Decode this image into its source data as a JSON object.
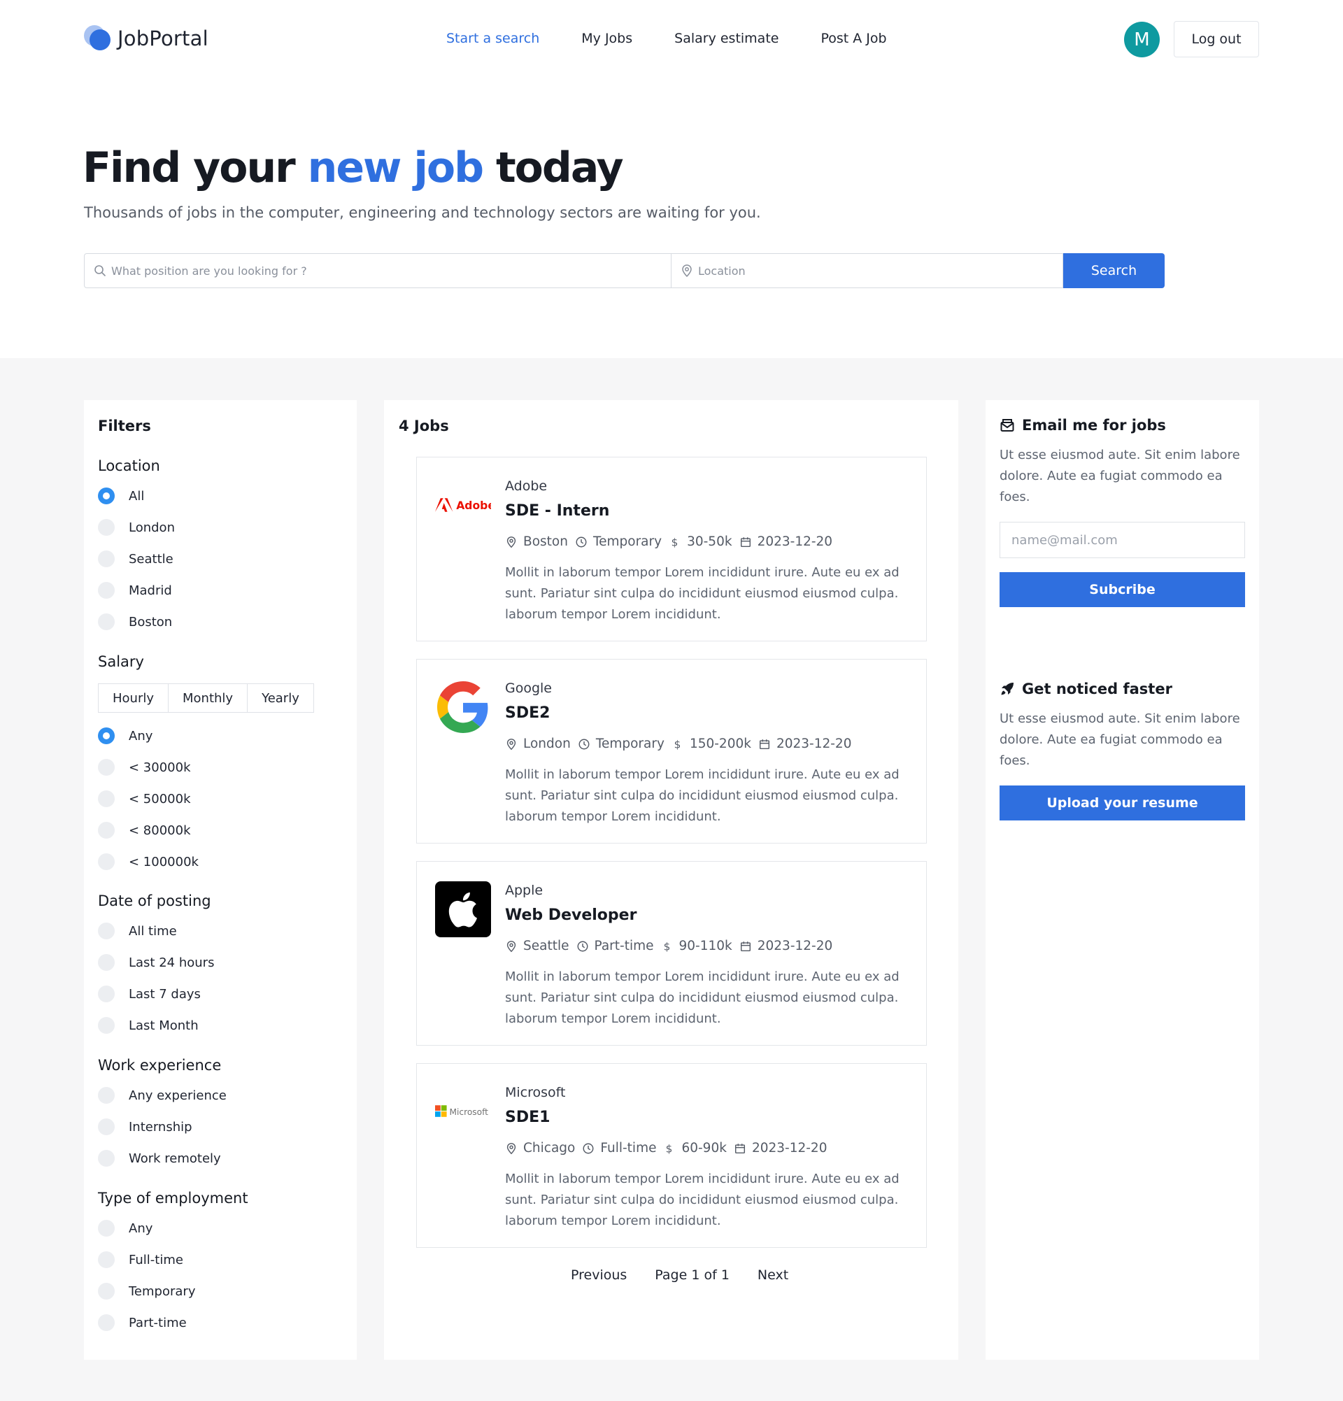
{
  "brand": {
    "name": "JobPortal"
  },
  "nav": {
    "items": [
      {
        "label": "Start a search",
        "active": true
      },
      {
        "label": "My Jobs",
        "active": false
      },
      {
        "label": "Salary estimate",
        "active": false
      },
      {
        "label": "Post A Job",
        "active": false
      }
    ]
  },
  "user": {
    "avatar_initial": "M",
    "logout_label": "Log out"
  },
  "hero": {
    "title_start": "Find your ",
    "title_highlight": "new job",
    "title_end": " today",
    "subtitle": "Thousands of jobs in the computer, engineering and technology sectors are waiting for you."
  },
  "search": {
    "position_placeholder": "What position are you looking for ?",
    "location_placeholder": "Location",
    "button_label": "Search"
  },
  "filters": {
    "title": "Filters",
    "location": {
      "title": "Location",
      "options": [
        "All",
        "London",
        "Seattle",
        "Madrid",
        "Boston"
      ],
      "selected": "All"
    },
    "salary": {
      "title": "Salary",
      "periods": [
        "Hourly",
        "Monthly",
        "Yearly"
      ],
      "options": [
        "Any",
        "< 30000k",
        "< 50000k",
        "< 80000k",
        "< 100000k"
      ],
      "selected": "Any"
    },
    "date": {
      "title": "Date of posting",
      "options": [
        "All time",
        "Last 24 hours",
        "Last 7 days",
        "Last Month"
      ]
    },
    "experience": {
      "title": "Work experience",
      "options": [
        "Any experience",
        "Internship",
        "Work remotely"
      ]
    },
    "employment": {
      "title": "Type of employment",
      "options": [
        "Any",
        "Full-time",
        "Temporary",
        "Part-time"
      ]
    }
  },
  "jobs": {
    "count_label": "4 Jobs",
    "items": [
      {
        "company": "Adobe",
        "logo": "adobe-logo",
        "logo_text": "Adobe",
        "title": "SDE - Intern",
        "location": "Boston",
        "type": "Temporary",
        "salary": "30-50k",
        "date": "2023-12-20",
        "description": "Mollit in laborum tempor Lorem incididunt irure. Aute eu ex ad sunt. Pariatur sint culpa do incididunt eiusmod eiusmod culpa. laborum tempor Lorem incididunt."
      },
      {
        "company": "Google",
        "logo": "google-logo",
        "title": "SDE2",
        "location": "London",
        "type": "Temporary",
        "salary": "150-200k",
        "date": "2023-12-20",
        "description": "Mollit in laborum tempor Lorem incididunt irure. Aute eu ex ad sunt. Pariatur sint culpa do incididunt eiusmod eiusmod culpa. laborum tempor Lorem incididunt."
      },
      {
        "company": "Apple",
        "logo": "apple-logo",
        "title": "Web Developer",
        "location": "Seattle",
        "type": "Part-time",
        "salary": "90-110k",
        "date": "2023-12-20",
        "description": "Mollit in laborum tempor Lorem incididunt irure. Aute eu ex ad sunt. Pariatur sint culpa do incididunt eiusmod eiusmod culpa. laborum tempor Lorem incididunt."
      },
      {
        "company": "Microsoft",
        "logo": "microsoft-logo",
        "logo_text": "Microsoft",
        "title": "SDE1",
        "location": "Chicago",
        "type": "Full-time",
        "salary": "60-90k",
        "date": "2023-12-20",
        "description": "Mollit in laborum tempor Lorem incididunt irure. Aute eu ex ad sunt. Pariatur sint culpa do incididunt eiusmod eiusmod culpa. laborum tempor Lorem incididunt."
      }
    ],
    "pagination": {
      "previous": "Previous",
      "info": "Page 1 of 1",
      "next": "Next"
    }
  },
  "aside": {
    "email": {
      "title": "Email me for jobs",
      "text": "Ut esse eiusmod aute. Sit enim labore dolore. Aute ea fugiat commodo ea foes.",
      "placeholder": "name@mail.com",
      "button_label": "Subcribe"
    },
    "noticed": {
      "title": "Get noticed faster",
      "text": "Ut esse eiusmod aute. Sit enim labore dolore. Aute ea fugiat commodo ea foes.",
      "button_label": "Upload your resume"
    }
  },
  "colors": {
    "accent": "#2f6fdf",
    "avatar": "#0f9aa0",
    "radio_checked": "#2f8ff0",
    "background": "#f6f6f7"
  }
}
